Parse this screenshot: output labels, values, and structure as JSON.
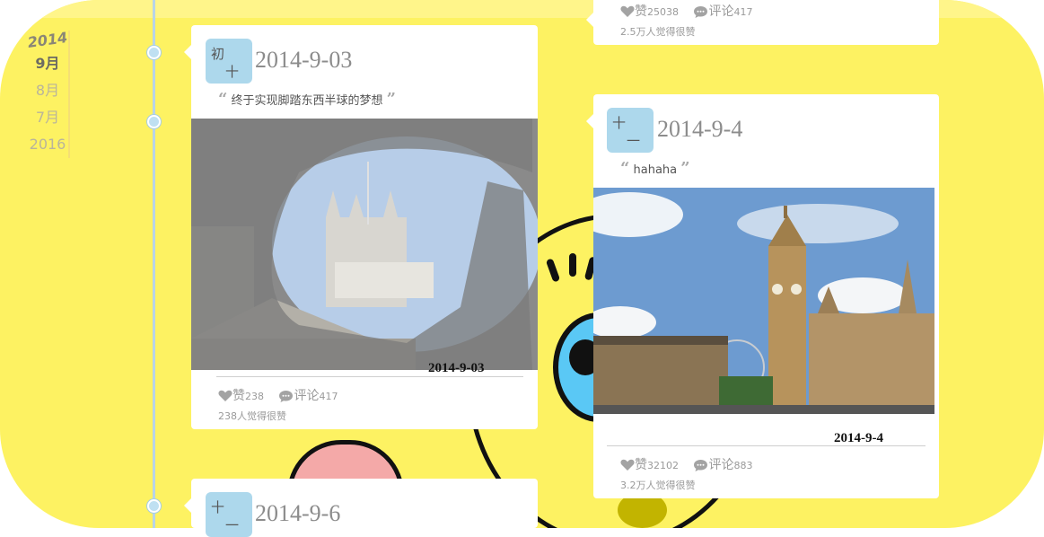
{
  "nav": {
    "year": "2014",
    "items": [
      "9月",
      "8月",
      "7月",
      "2016"
    ]
  },
  "cards": [
    {
      "badge_top": "初",
      "badge_bottom": "十",
      "date": "2014-9-03",
      "quote": "终于实现脚踏东西半球的梦想",
      "photo_caption": "2014-9-03",
      "like_label": "赞",
      "like_count": "238",
      "comment_label": "评论",
      "comment_count": "417",
      "liked_text": "238人觉得很赞"
    },
    {
      "badge_top": "十",
      "badge_bottom": "一",
      "date": "2014-9-4",
      "quote": "hahaha",
      "photo_caption": "2014-9-4",
      "like_label": "赞",
      "like_count": "32102",
      "comment_label": "评论",
      "comment_count": "883",
      "liked_text": "3.2万人觉得很赞"
    },
    {
      "like_label": "赞",
      "like_count": "25038",
      "comment_label": "评论",
      "comment_count": "417",
      "liked_text": "2.5万人觉得很赞"
    },
    {
      "badge_top": "十",
      "badge_bottom": "一",
      "date": "2014-9-6"
    }
  ],
  "colors": {
    "background": "#fdf262",
    "badge": "#add8ec",
    "timeline": "#b8d4e6"
  },
  "icons": [
    "heart-icon",
    "comment-bubble-icon",
    "quote-open-icon",
    "quote-close-icon"
  ]
}
